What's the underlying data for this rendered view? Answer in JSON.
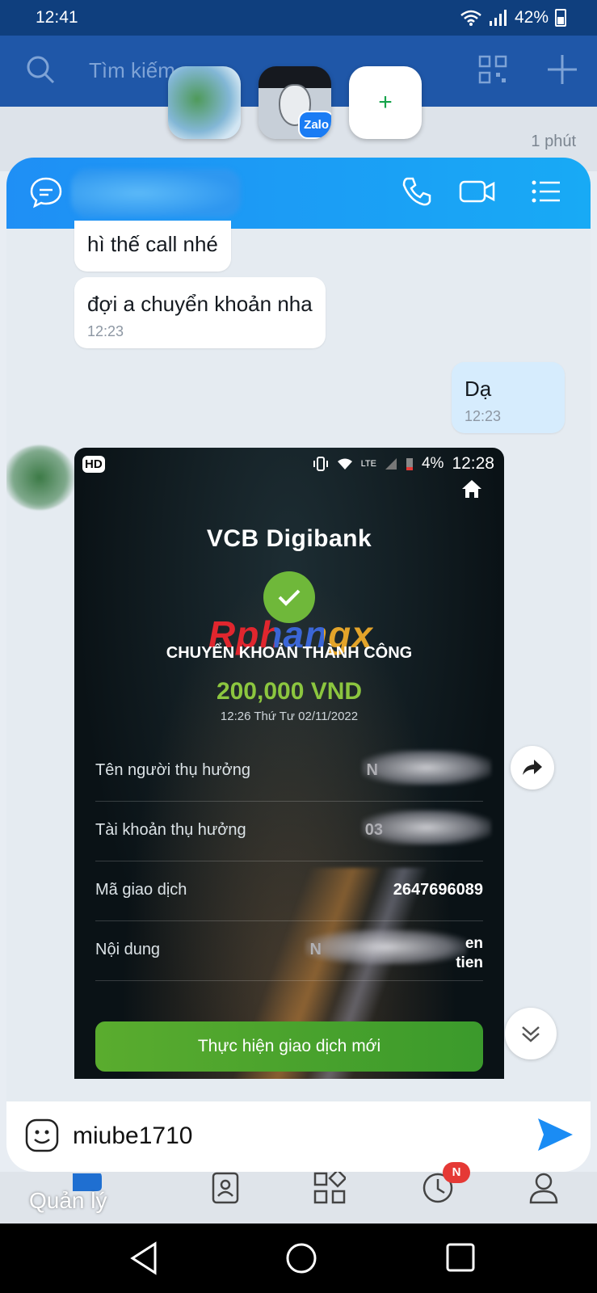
{
  "status_bar": {
    "time": "12:41",
    "battery": "42%"
  },
  "background": {
    "search_placeholder": "Tìm kiếm",
    "list_time_ago": "1 phút"
  },
  "floating_bubbles": {
    "zalo_badge": "Zalo",
    "add": "+"
  },
  "chat": {
    "messages": [
      {
        "text": "hì thế call nhé",
        "time": ""
      },
      {
        "text": "đợi a chuyển khoản nha",
        "time": "12:23"
      },
      {
        "text": "Dạ",
        "time": "12:23"
      }
    ],
    "input_text": "miube1710"
  },
  "receipt": {
    "hd": "HD",
    "battery": "4%",
    "time": "12:28",
    "network": "LTE",
    "brand": "VCB Digibank",
    "watermark": "Rphangx",
    "status": "CHUYỂN KHOẢN THÀNH CÔNG",
    "amount": "200,000 VND",
    "datetime": "12:26 Thứ Tư 02/11/2022",
    "rows": [
      {
        "label": "Tên người thụ hưởng",
        "value": "N"
      },
      {
        "label": "Tài khoản thụ hưởng",
        "value": "03"
      },
      {
        "label": "Mã giao dịch",
        "value": "2647696089"
      },
      {
        "label": "Nội dung",
        "value": "N",
        "tail": "en\ntien"
      }
    ],
    "button": "Thực hiện giao dịch mới"
  },
  "tabbar": {
    "label": "Quản lý",
    "badge": "N"
  },
  "colors": {
    "header_blue": "#1f8ff5",
    "vcb_green": "#8cc63f",
    "send_blue": "#1a8cf4"
  }
}
